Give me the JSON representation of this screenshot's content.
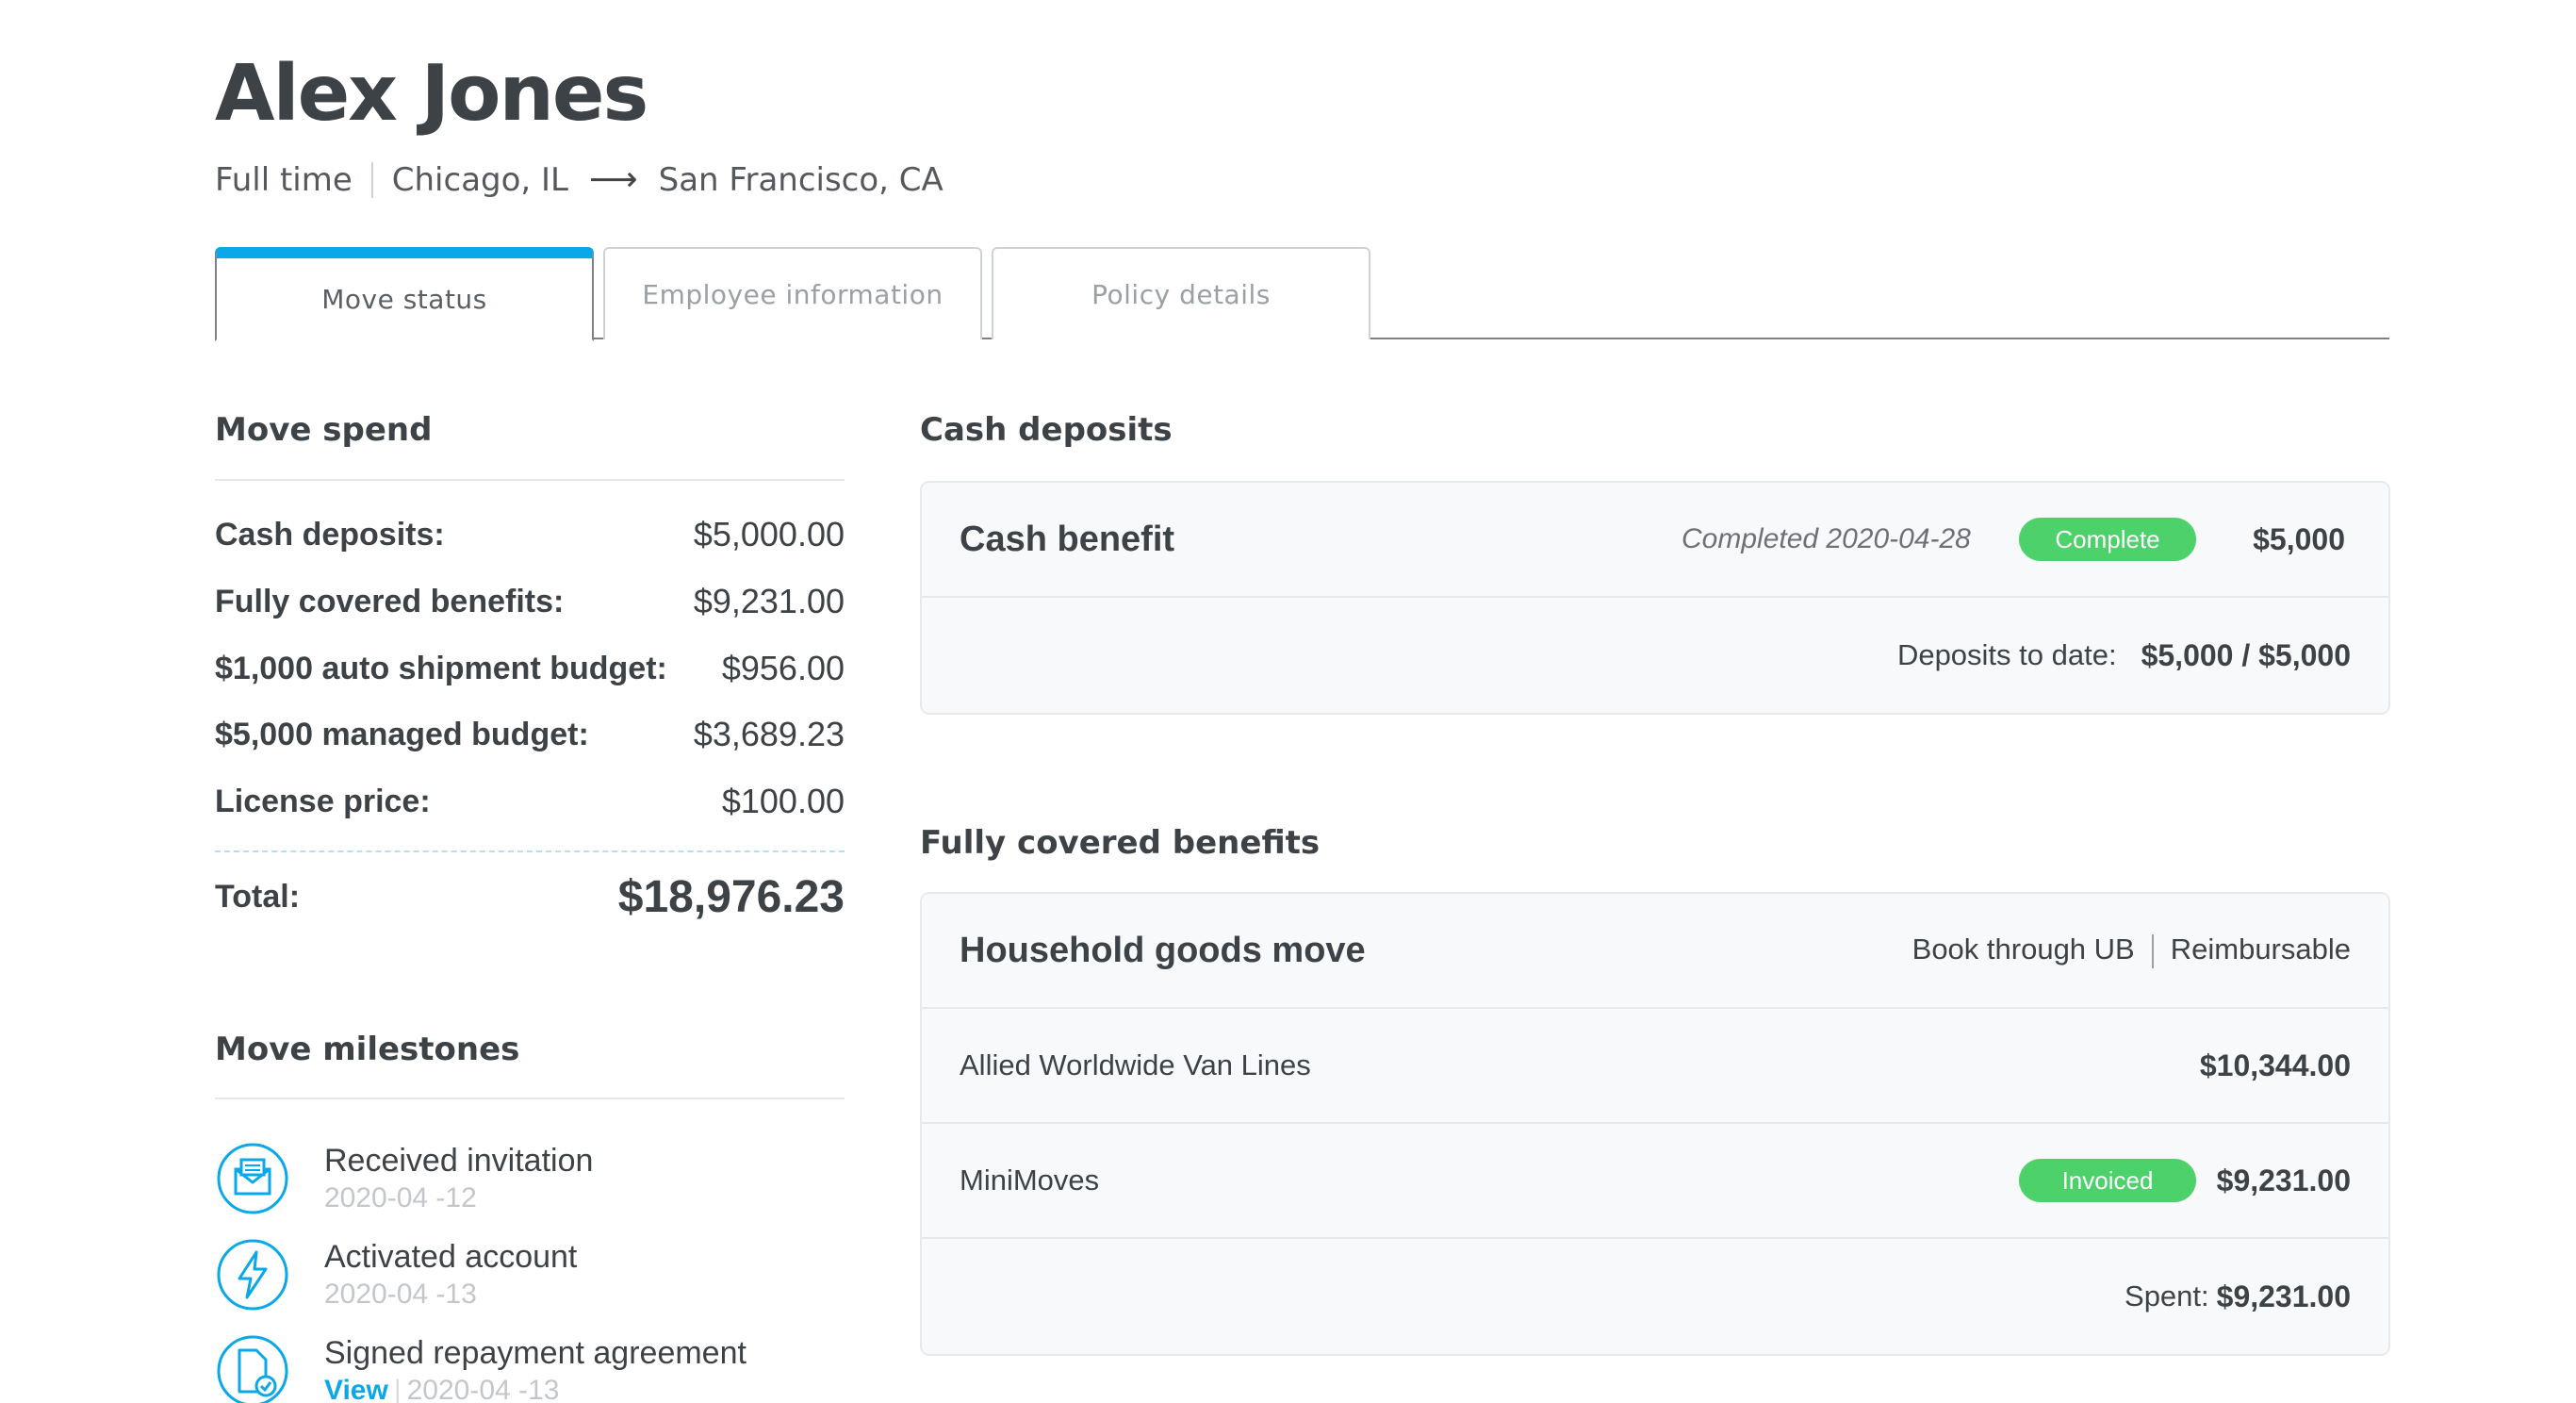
{
  "header": {
    "name": "Alex Jones",
    "employment": "Full time",
    "from": "Chicago, IL",
    "arrow": "⟶",
    "to": "San Francisco, CA"
  },
  "tabs": [
    {
      "label": "Move status",
      "active": true
    },
    {
      "label": "Employee information",
      "active": false
    },
    {
      "label": "Policy details",
      "active": false
    }
  ],
  "move_spend": {
    "title": "Move spend",
    "rows": [
      {
        "label": "Cash deposits:",
        "value": "$5,000.00"
      },
      {
        "label": "Fully covered benefits:",
        "value": "$9,231.00"
      },
      {
        "label": "$1,000 auto shipment budget:",
        "value": "$956.00"
      },
      {
        "label": "$5,000 managed budget:",
        "value": "$3,689.23"
      },
      {
        "label": "License price:",
        "value": "$100.00"
      }
    ],
    "total_label": "Total:",
    "total_value": "$18,976.23"
  },
  "milestones": {
    "title": "Move milestones",
    "items": [
      {
        "title": "Received invitation",
        "date": "2020-04 -12",
        "icon": "envelope-icon"
      },
      {
        "title": "Activated account",
        "date": "2020-04 -13",
        "icon": "lightning-icon"
      },
      {
        "title": "Signed repayment agreement",
        "link": "View",
        "date": "2020-04 -13",
        "icon": "signed-document-icon"
      }
    ]
  },
  "cash_deposits": {
    "title": "Cash deposits",
    "item_title": "Cash benefit",
    "completed": "Completed 2020-04-28",
    "status": "Complete",
    "amount": "$5,000",
    "to_date_label": "Deposits to date:",
    "to_date_value": "$5,000 / $5,000"
  },
  "fully_covered": {
    "title": "Fully covered benefits",
    "item_title": "Household goods move",
    "book_through": "Book through UB",
    "reimbursable": "Reimbursable",
    "vendors": [
      {
        "name": "Allied Worldwide Van Lines",
        "amount": "$10,344.00",
        "status": ""
      },
      {
        "name": "MiniMoves",
        "amount": "$9,231.00",
        "status": "Invoiced"
      }
    ],
    "spent_label": "Spent:",
    "spent_value": "$9,231.00"
  },
  "colors": {
    "accent_blue": "#0aa8e8",
    "status_green": "#4dd26b",
    "text_dark": "#3d4246"
  }
}
